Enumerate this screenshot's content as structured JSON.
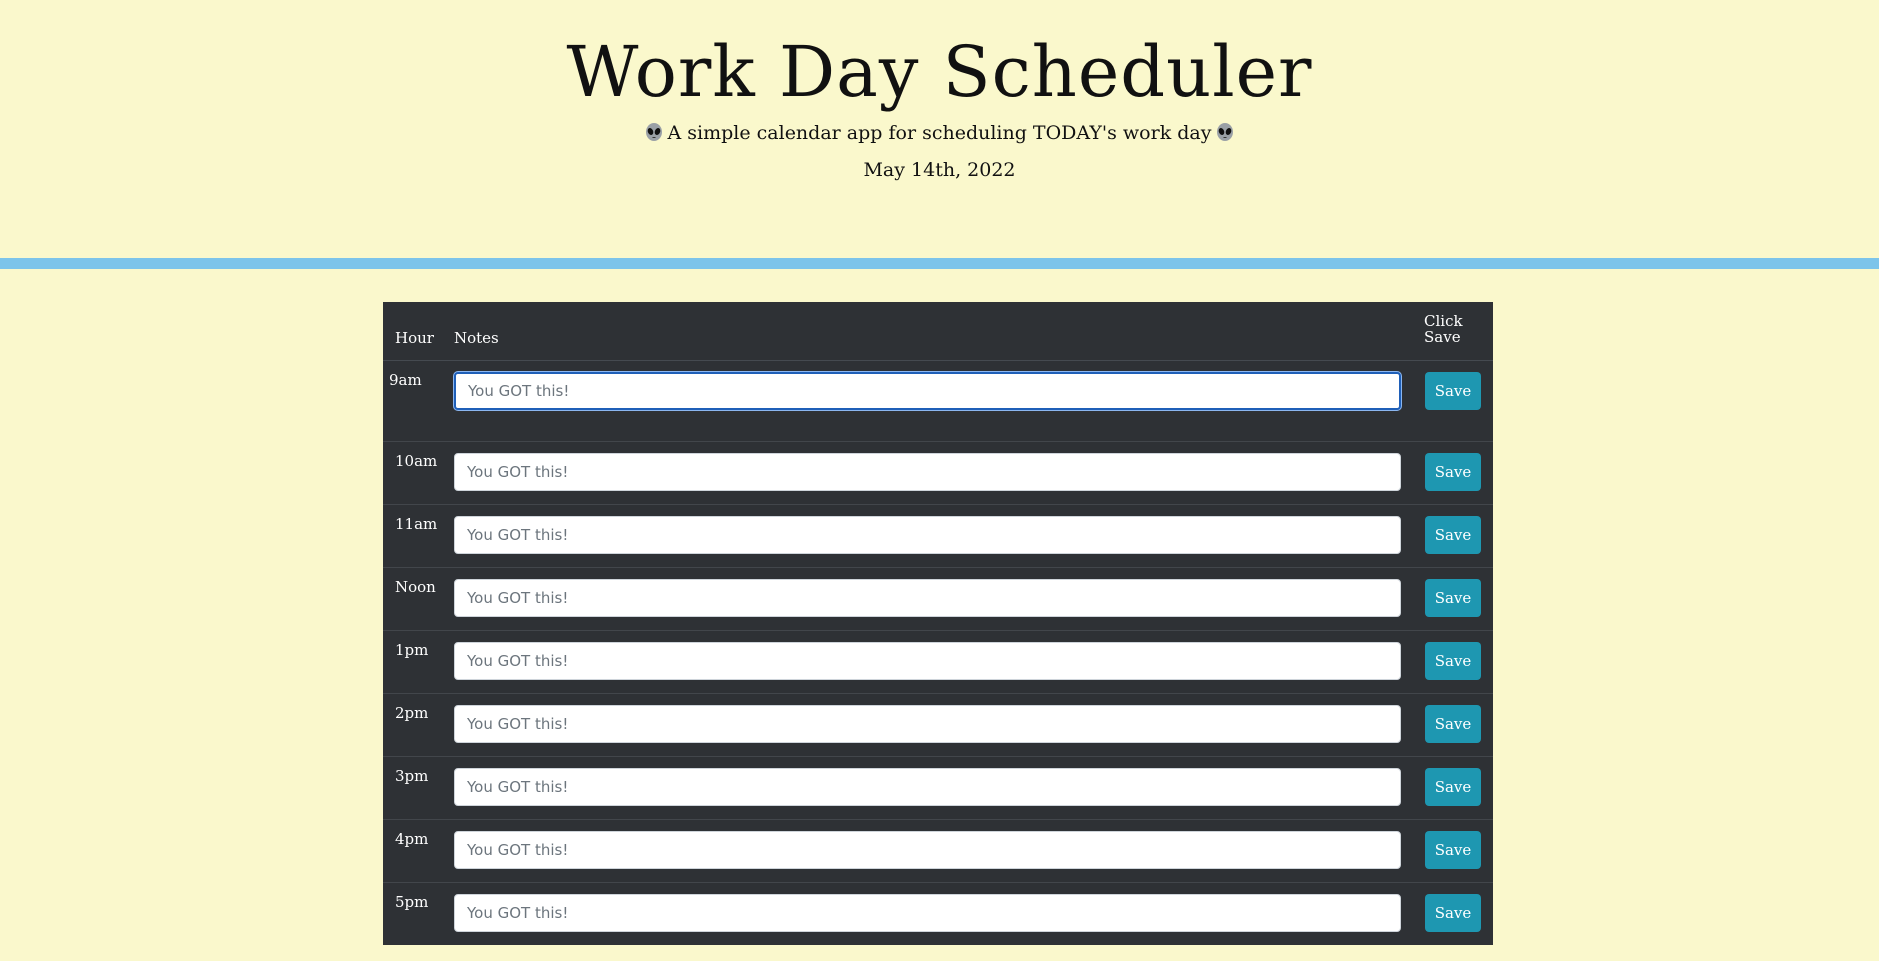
{
  "header": {
    "title": "Work Day Scheduler",
    "subtitle": "A simple calendar app for scheduling TODAY's work day",
    "subtitle_icon": "alien-icon",
    "date": "May 14th, 2022"
  },
  "table": {
    "columns": {
      "hour": "Hour",
      "notes": "Notes",
      "save": "Click Save"
    },
    "rows": [
      {
        "hour": "9am",
        "placeholder": "You GOT this!",
        "value": "",
        "save_label": "Save",
        "focused": true
      },
      {
        "hour": "10am",
        "placeholder": "You GOT this!",
        "value": "",
        "save_label": "Save"
      },
      {
        "hour": "11am",
        "placeholder": "You GOT this!",
        "value": "",
        "save_label": "Save"
      },
      {
        "hour": "Noon",
        "placeholder": "You GOT this!",
        "value": "",
        "save_label": "Save"
      },
      {
        "hour": "1pm",
        "placeholder": "You GOT this!",
        "value": "",
        "save_label": "Save"
      },
      {
        "hour": "2pm",
        "placeholder": "You GOT this!",
        "value": "",
        "save_label": "Save"
      },
      {
        "hour": "3pm",
        "placeholder": "You GOT this!",
        "value": "",
        "save_label": "Save"
      },
      {
        "hour": "4pm",
        "placeholder": "You GOT this!",
        "value": "",
        "save_label": "Save"
      },
      {
        "hour": "5pm",
        "placeholder": "You GOT this!",
        "value": "",
        "save_label": "Save"
      }
    ]
  },
  "colors": {
    "page_background": "#faf8cc",
    "divider": "#7cc4ea",
    "table_background": "#2e3135",
    "save_button": "#1e97b1",
    "focus_border": "#1f5fb8"
  }
}
